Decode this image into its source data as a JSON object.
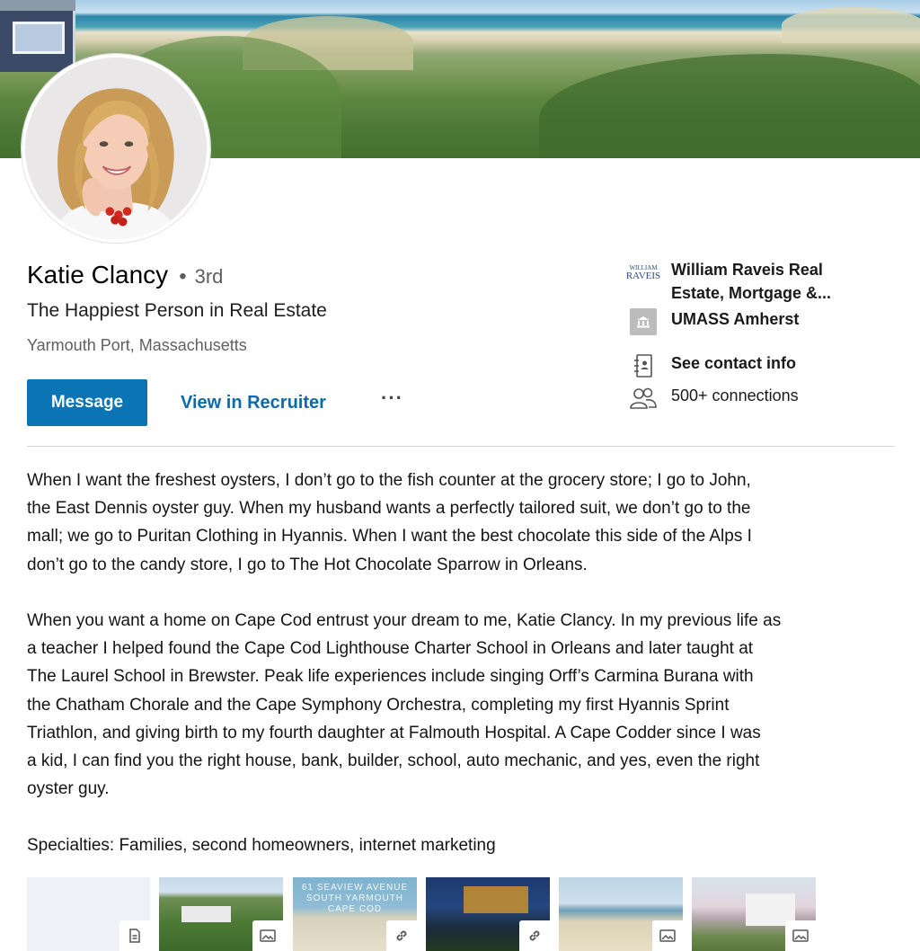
{
  "profile": {
    "name": "Katie Clancy",
    "separator": "•",
    "degree": "3rd",
    "headline": "The Happiest Person in Real Estate",
    "location": "Yarmouth Port, Massachusetts"
  },
  "actions": {
    "message_label": "Message",
    "recruiter_label": "View in Recruiter",
    "more_label": "···"
  },
  "sidebar": {
    "company_logo_line1": "WILLIAM",
    "company_logo_line2": "RAVEIS",
    "company_line1": "William Raveis Real",
    "company_line2": "Estate, Mortgage &...",
    "school": "UMASS Amherst",
    "contact_label": "See contact info",
    "connections": "500+ connections"
  },
  "summary": {
    "paragraph1": [
      "When I want the freshest oysters, I don’t go to the fish counter at the grocery store; I go to John,",
      "the East Dennis oyster guy. When my husband wants a perfectly tailored suit, we don’t go to the",
      "mall; we go to Puritan Clothing in Hyannis. When I want the best chocolate this side of the Alps I",
      "don’t go to the candy store, I go to The Hot Chocolate Sparrow in Orleans."
    ],
    "paragraph2": [
      "When you want a home on Cape Cod entrust your dream to me, Katie Clancy. In my previous life as",
      "a teacher I helped found the Cape Cod Lighthouse Charter School in Orleans and later taught at",
      "The Laurel School in Brewster. Peak life experiences include singing Orff’s Carmina Burana with",
      "the Chatham Chorale and the Cape Symphony Orchestra, completing my first Hyannis Sprint",
      "Triathlon, and giving birth to my fourth daughter at Falmouth Hospital. A Cape Codder since I was",
      "a kid, I can find you the right house, bank, builder, school, auto mechanic, and yes, even the right",
      "oyster guy."
    ],
    "specialties": "Specialties: Families, second homeowners, internet marketing"
  },
  "media": {
    "caption_line1": "61 SEAVIEW AVENUE",
    "caption_line2": "SOUTH YARMOUTH",
    "caption_line3": "CAPE COD",
    "items": [
      {
        "type": "document",
        "icon": "document-icon"
      },
      {
        "type": "image",
        "icon": "image-icon"
      },
      {
        "type": "link",
        "icon": "link-icon"
      },
      {
        "type": "link",
        "icon": "link-icon"
      },
      {
        "type": "image",
        "icon": "image-icon"
      },
      {
        "type": "image",
        "icon": "image-icon"
      }
    ]
  },
  "colors": {
    "accent": "#0b74b5",
    "link": "#0b6ba8",
    "text": "#1d1d1d",
    "muted": "#606060"
  }
}
